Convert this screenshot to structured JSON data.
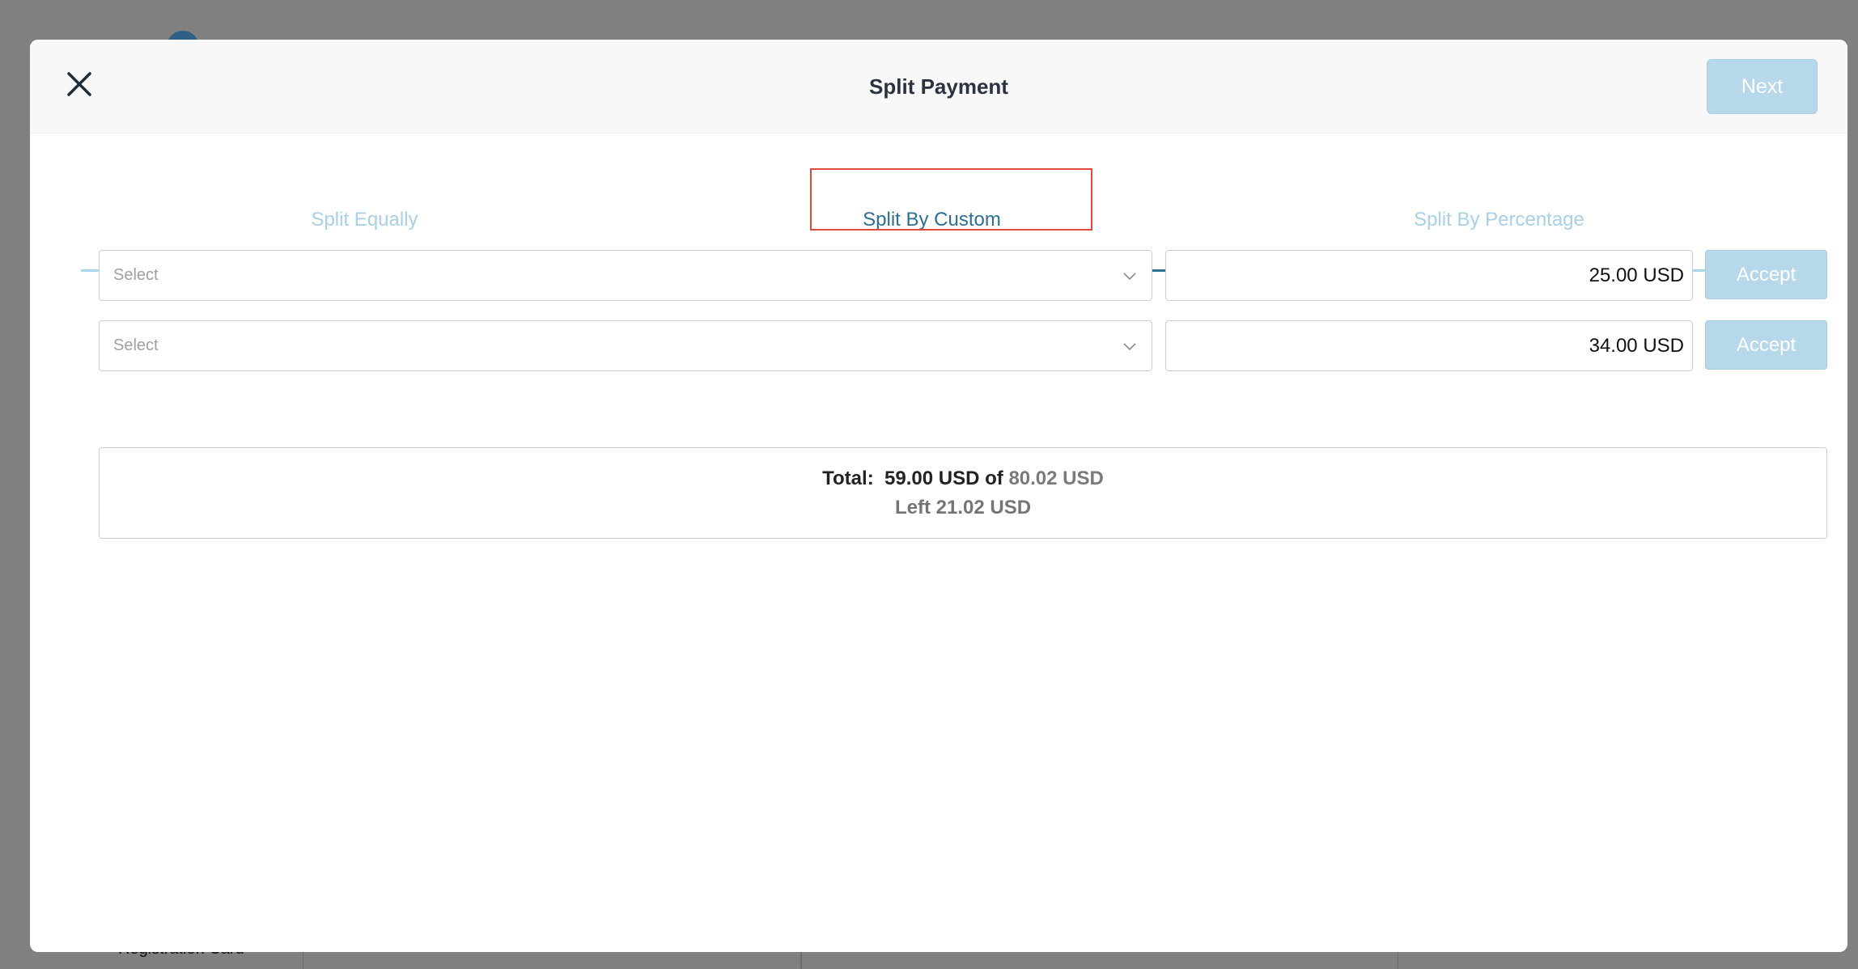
{
  "background": {
    "registration_label": "Registration Card"
  },
  "modal": {
    "title": "Split Payment",
    "next_label": "Next"
  },
  "tabs": [
    {
      "label": "Split Equally",
      "active": false
    },
    {
      "label": "Split By Custom",
      "active": true
    },
    {
      "label": "Split By Percentage",
      "active": false
    }
  ],
  "rows": [
    {
      "select_placeholder": "Select",
      "amount": "25.00 USD",
      "accept_label": "Accept"
    },
    {
      "select_placeholder": "Select",
      "amount": "34.00 USD",
      "accept_label": "Accept"
    }
  ],
  "summary": {
    "total_label": "Total:",
    "total_value": "59.00 USD",
    "of_label": "of",
    "grand_total": "80.02 USD",
    "left_text": "Left 21.02 USD"
  },
  "colors": {
    "accent": "#2c6e94",
    "button_disabled": "#b7d7ea",
    "tab_inactive": "#a8d0e6",
    "highlight_box": "#e04a3a"
  },
  "icons": {
    "close": "close-icon",
    "dropdown": "chevron-down-icon"
  }
}
